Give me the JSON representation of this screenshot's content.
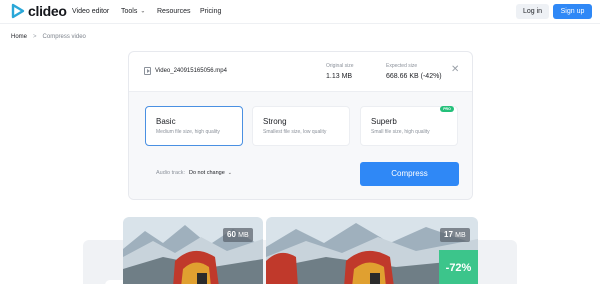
{
  "header": {
    "brand": "clideo",
    "nav": {
      "video_editor": "Video editor",
      "tools": "Tools",
      "resources": "Resources",
      "pricing": "Pricing"
    },
    "login": "Log in",
    "signup": "Sign up"
  },
  "breadcrumb": {
    "home": "Home",
    "separator": ">",
    "current": "Compress video"
  },
  "file": {
    "name": "Video_240915165056.mp4",
    "original_label": "Original size",
    "original_value": "1.13 MB",
    "expected_label": "Expected size",
    "expected_value": "668.66 KB (-42%)"
  },
  "options": [
    {
      "title": "Basic",
      "desc": "Medium file size, high quality",
      "selected": true
    },
    {
      "title": "Strong",
      "desc": "Smallest file size, low quality",
      "selected": false
    },
    {
      "title": "Superb",
      "desc": "Small file size, high quality",
      "badge": "PRO",
      "selected": false
    }
  ],
  "audio": {
    "label": "Audio track:",
    "value": "Do not change"
  },
  "compress_button": "Compress",
  "preview": {
    "before_size": "60",
    "before_unit": "MB",
    "after_size": "17",
    "after_unit": "MB",
    "reduction": "-72%"
  },
  "colors": {
    "accent": "#2f88f6",
    "success": "#3cc58b",
    "selected_border": "#4a90e2"
  }
}
